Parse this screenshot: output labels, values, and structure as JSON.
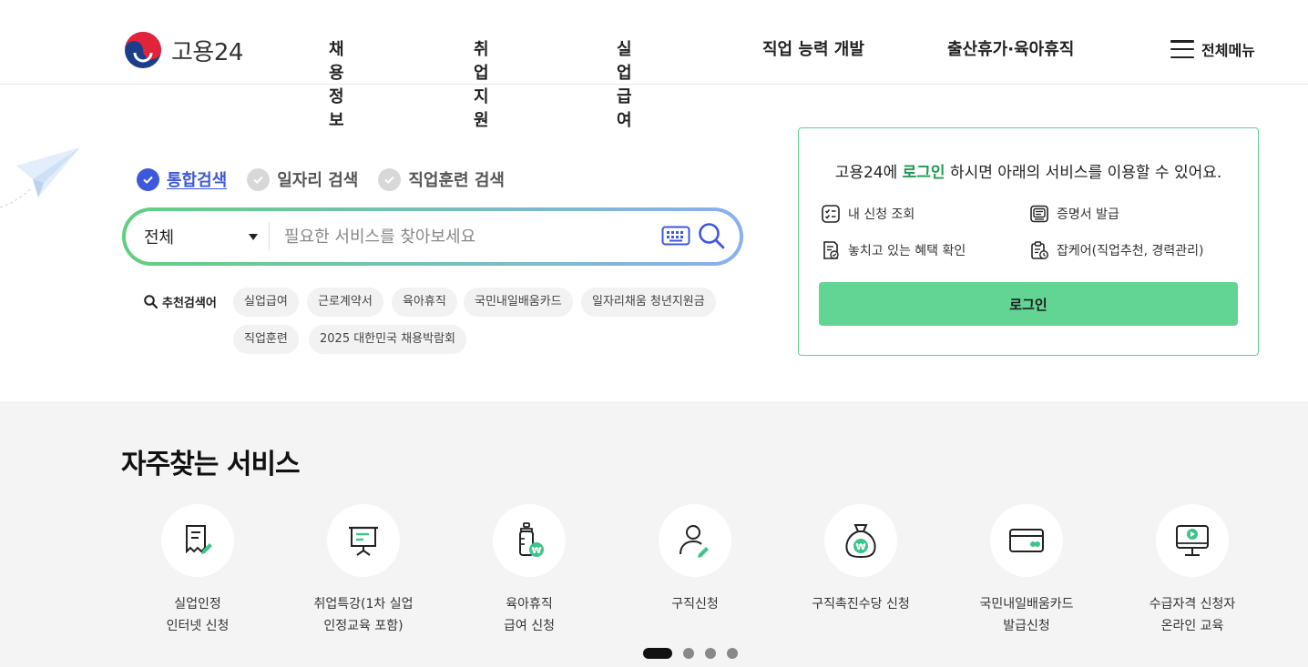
{
  "header": {
    "logo_text": "고용24",
    "nav": [
      "채용정보",
      "취업지원",
      "실업급여",
      "직업 능력 개발",
      "출산휴가·육아휴직"
    ],
    "all_menu_label": "전체메뉴"
  },
  "search": {
    "tabs": [
      {
        "label": "통합검색",
        "active": true
      },
      {
        "label": "일자리 검색",
        "active": false
      },
      {
        "label": "직업훈련 검색",
        "active": false
      }
    ],
    "select_value": "전체",
    "placeholder": "필요한 서비스를 찾아보세요",
    "recommend_title": "추천검색어",
    "keywords": [
      "실업급여",
      "근로계약서",
      "육아휴직",
      "국민내일배움카드",
      "일자리채움 청년지원금",
      "직업훈련",
      "2025 대한민국 채용박람회"
    ]
  },
  "login": {
    "message_before": "고용24에 ",
    "message_highlight": "로그인",
    "message_after": " 하시면 아래의 서비스를 이용할 수 있어요.",
    "services": [
      {
        "label": "내 신청 조회",
        "icon": "checklist-icon"
      },
      {
        "label": "증명서 발급",
        "icon": "certificate-icon"
      },
      {
        "label": "놓치고 있는 혜택 확인",
        "icon": "benefit-doc-icon"
      },
      {
        "label": "잡케어(직업추천, 경력관리)",
        "icon": "jobcare-icon"
      }
    ],
    "button_label": "로그인",
    "accent_color": "#62d494"
  },
  "frequent": {
    "title": "자주찾는 서비스",
    "items": [
      {
        "label": "실업인정\n인터넷 신청",
        "icon": "document-pen-icon"
      },
      {
        "label": "취업특강(1차 실업\n인정교육 포함)",
        "icon": "presentation-board-icon"
      },
      {
        "label": "육아휴직\n급여 신청",
        "icon": "baby-bottle-won-icon"
      },
      {
        "label": "구직신청",
        "icon": "person-pen-icon"
      },
      {
        "label": "구직촉진수당 신청",
        "icon": "money-bag-won-icon"
      },
      {
        "label": "국민내일배움카드\n발급신청",
        "icon": "card-icon"
      },
      {
        "label": "수급자격 신청자\n온라인 교육",
        "icon": "monitor-play-icon"
      }
    ],
    "pager": {
      "total": 4,
      "current": 1
    }
  }
}
